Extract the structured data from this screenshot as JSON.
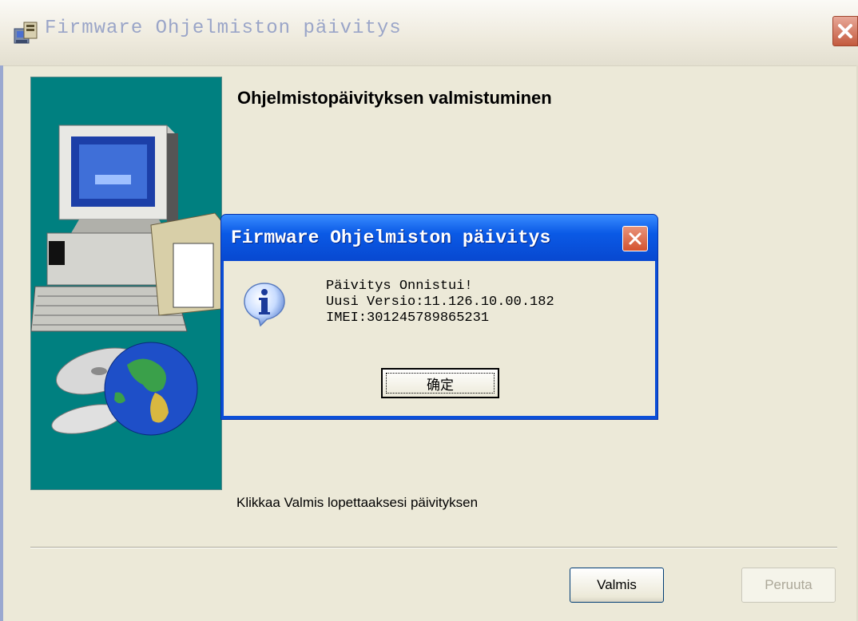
{
  "window": {
    "title": "Firmware Ohjelmiston päivitys",
    "heading": "Ohjelmistopäivityksen valmistuminen",
    "footer_text": "Klikkaa Valmis lopettaaksesi päivityksen",
    "buttons": {
      "finish": "Valmis",
      "cancel": "Peruuta"
    }
  },
  "dialog": {
    "title": "Firmware Ohjelmiston päivitys",
    "lines": [
      "Päivitys Onnistui!",
      "Uusi Versio:11.126.10.00.182",
      "IMEI:301245789865231"
    ],
    "ok_label": "确定"
  },
  "icons": {
    "app": "installer-icon",
    "close": "close-icon",
    "info": "info-icon",
    "banner": "computer-globe-illustration"
  },
  "colors": {
    "banner_bg": "#008080",
    "dialog_title": "#0a5ae6",
    "close_red": "#d4532f",
    "window_bg": "#ece9d8"
  }
}
